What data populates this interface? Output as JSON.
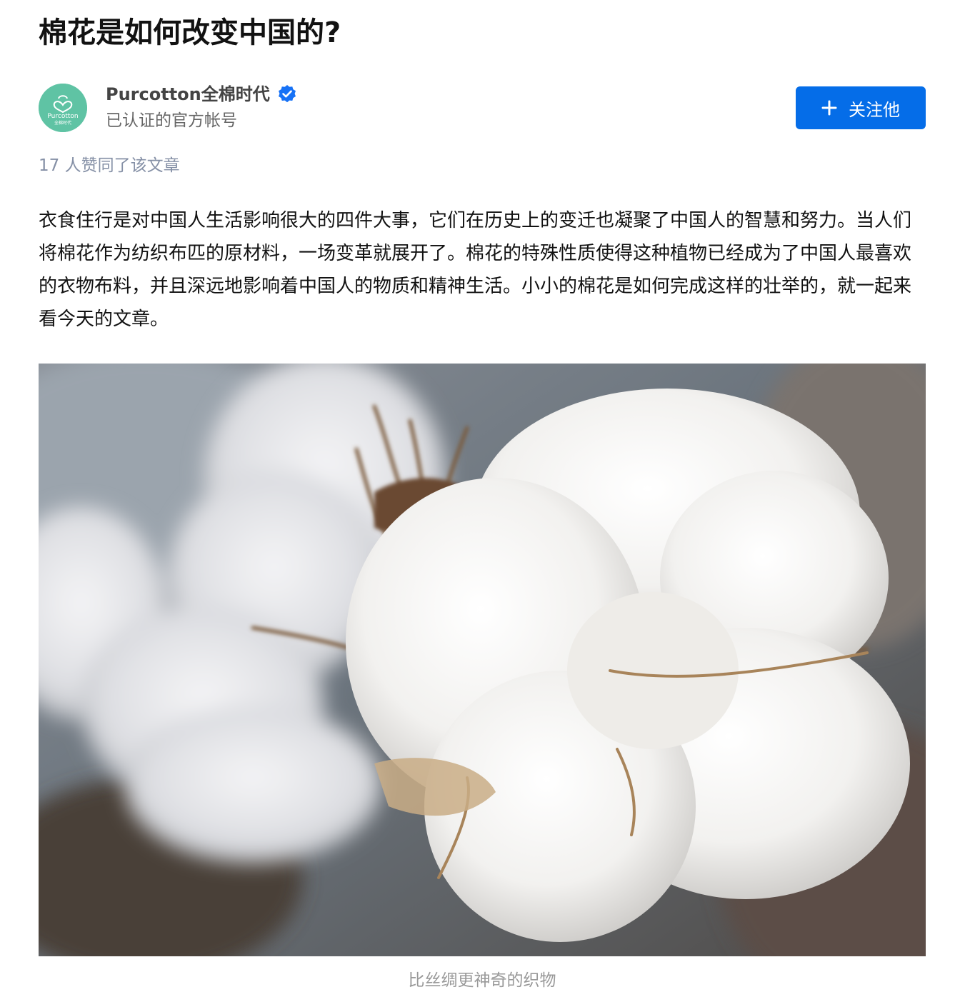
{
  "article": {
    "title": "棉花是如何改变中国的?",
    "author": {
      "name": "Purcotton全棉时代",
      "description": "已认证的官方帐号",
      "avatar_logo_text": "Purcotton",
      "avatar_logo_subtext": "全棉时代",
      "verified_icon": "verified-badge-icon",
      "verified_color": "#1772f6"
    },
    "follow_button_label": "关注他",
    "follow_icon": "plus-icon",
    "accent_color": "#056de8",
    "likes_text": "17 人赞同了该文章",
    "body": "衣食住行是对中国人生活影响很大的四件大事，它们在历史上的变迁也凝聚了中国人的智慧和努力。当人们将棉花作为纺织布匹的原材料，一场变革就展开了。棉花的特殊性质使得这种植物已经成为了中国人最喜欢的衣物布料，并且深远地影响着中国人的物质和精神生活。小小的棉花是如何完成这样的壮举的，就一起来看今天的文章。",
    "image_caption": "比丝绸更神奇的织物"
  }
}
